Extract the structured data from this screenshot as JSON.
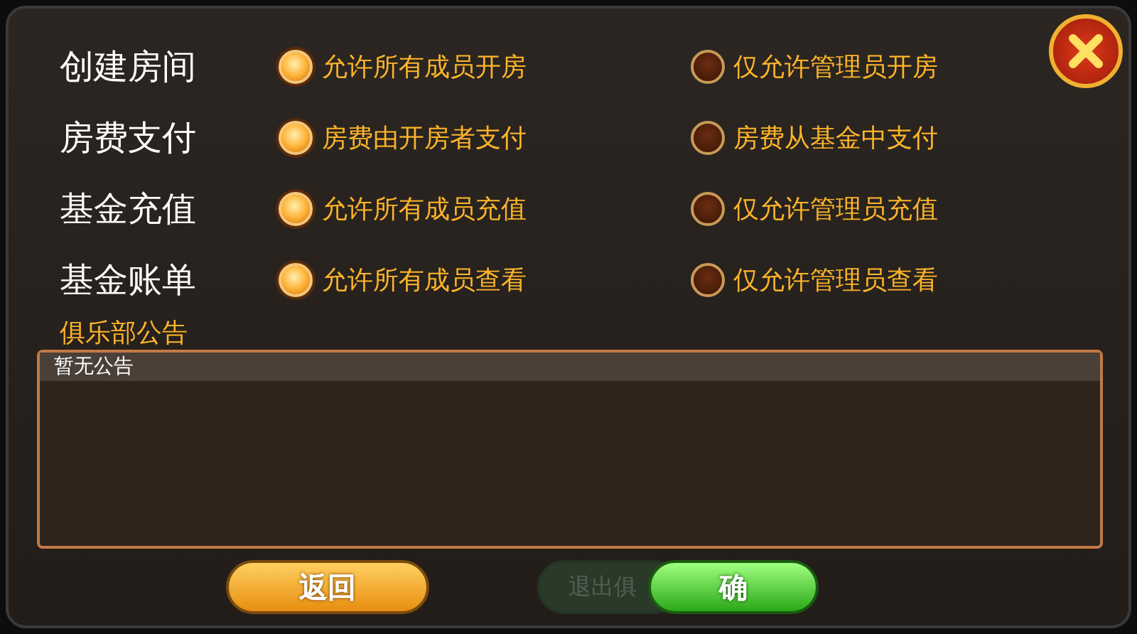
{
  "settings": [
    {
      "label": "创建房间",
      "options": [
        {
          "label": "允许所有成员开房",
          "selected": true
        },
        {
          "label": "仅允许管理员开房",
          "selected": false
        }
      ]
    },
    {
      "label": "房费支付",
      "options": [
        {
          "label": "房费由开房者支付",
          "selected": true
        },
        {
          "label": "房费从基金中支付",
          "selected": false
        }
      ]
    },
    {
      "label": "基金充值",
      "options": [
        {
          "label": "允许所有成员充值",
          "selected": true
        },
        {
          "label": "仅允许管理员充值",
          "selected": false
        }
      ]
    },
    {
      "label": "基金账单",
      "options": [
        {
          "label": "允许所有成员查看",
          "selected": true
        },
        {
          "label": "仅允许管理员查看",
          "selected": false
        }
      ]
    }
  ],
  "notice": {
    "title": "俱乐部公告",
    "header": "暂无公告"
  },
  "buttons": [
    {
      "kind": "back",
      "label": "返回"
    },
    {
      "kind": "faded",
      "label": "退出俱"
    },
    {
      "kind": "confirm",
      "label": "确"
    }
  ]
}
